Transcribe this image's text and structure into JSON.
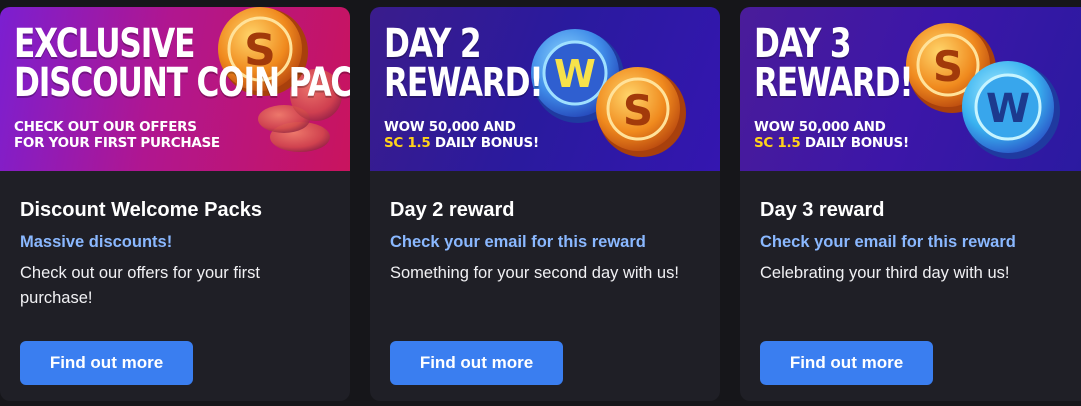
{
  "cards": [
    {
      "banner_headline_line1": "EXCLUSIVE",
      "banner_headline_line2": "DISCOUNT COIN PACKS",
      "banner_sub_line1": "CHECK OUT OUR OFFERS",
      "banner_sub_line2": "FOR YOUR FIRST PURCHASE",
      "coin_label_s": "S",
      "title": "Discount Welcome Packs",
      "tagline": "Massive discounts!",
      "description": "Check out our offers for your first purchase!",
      "button_label": "Find out more"
    },
    {
      "banner_headline_line1": "DAY 2",
      "banner_headline_line2": "REWARD!",
      "banner_sub_line1": "WOW 50,000 AND",
      "banner_sub_highlight": "SC 1.5",
      "banner_sub_line2_rest": " DAILY BONUS!",
      "coin_label_w": "W",
      "coin_label_s": "S",
      "title": "Day 2 reward",
      "tagline": "Check your email for this reward",
      "description": "Something for your second day with us!",
      "button_label": "Find out more"
    },
    {
      "banner_headline_line1": "DAY 3",
      "banner_headline_line2": "REWARD!",
      "banner_sub_line1": "WOW 50,000 AND",
      "banner_sub_highlight": "SC 1.5",
      "banner_sub_line2_rest": " DAILY BONUS!",
      "coin_label_w": "W",
      "coin_label_s": "S",
      "title": "Day 3 reward",
      "tagline": "Check your email for this reward",
      "description": "Celebrating your third day with us!",
      "button_label": "Find out more"
    }
  ],
  "colors": {
    "page_bg": "#16161a",
    "card_bg": "#1f1f26",
    "tagline": "#8ab8ff",
    "button": "#3a7ef0",
    "highlight": "#ffd21a"
  }
}
